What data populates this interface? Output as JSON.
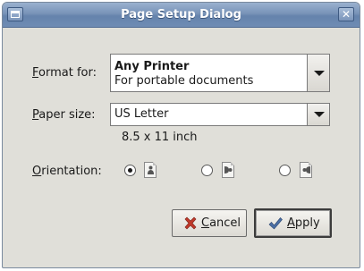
{
  "window": {
    "title": "Page Setup Dialog",
    "menu_icon": "window-menu-icon",
    "close_glyph": "✕"
  },
  "format": {
    "label_mnemonic": "F",
    "label_rest": "ormat for:",
    "printer_name": "Any Printer",
    "printer_desc": "For portable documents"
  },
  "paper": {
    "label_mnemonic": "P",
    "label_rest": "aper size:",
    "value": "US Letter",
    "dimensions": "8.5 x 11 inch"
  },
  "orientation": {
    "label_mnemonic": "O",
    "label_rest": "rientation:",
    "options": [
      {
        "icon": "portrait-icon",
        "checked": true
      },
      {
        "icon": "landscape-icon",
        "checked": false
      },
      {
        "icon": "reverse-landscape-icon",
        "checked": false
      }
    ]
  },
  "buttons": {
    "cancel_mnemonic": "C",
    "cancel_rest": "ancel",
    "apply_mnemonic": "A",
    "apply_rest": "pply",
    "cancel_icon": "cancel-x-icon",
    "apply_icon": "checkmark-icon"
  },
  "colors": {
    "titlebar": "#7893b8",
    "dialog_bg": "#e0dfd9",
    "cancel_icon": "#c0392b",
    "apply_icon": "#4a6fa5"
  }
}
